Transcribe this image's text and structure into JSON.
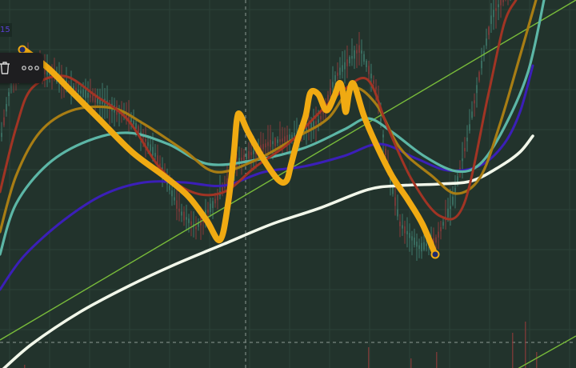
{
  "price_tag": {
    "label": "15",
    "color": "#5b3fd6"
  },
  "toolbar": {
    "delete_icon": "trash-icon",
    "more_icon": "more-horizontal-icon"
  },
  "colors": {
    "background": "#22332c",
    "grid": "#2c4038",
    "candle_up": "#3f7a6c",
    "candle_down": "#8a3a3a",
    "drawing": "#f0aa12",
    "trend": "#78bb3a",
    "ma_white": "#f2f7ea",
    "ma_purple": "#3b1fb8",
    "ma_teal": "#5cb6a6",
    "ma_gold": "#a87d14",
    "ma_red": "#a13424"
  }
}
